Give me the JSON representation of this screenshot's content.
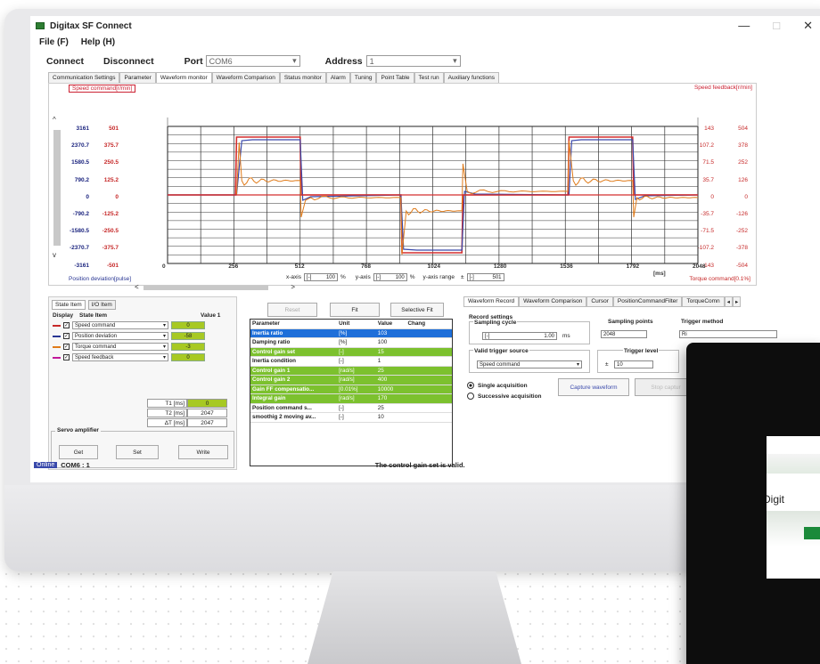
{
  "window": {
    "title": "Digitax SF Connect",
    "min": "—",
    "max": "□",
    "close": "✕"
  },
  "menu": {
    "file": "File (F)",
    "help": "Help (H)"
  },
  "conn": {
    "connect": "Connect",
    "disconnect": "Disconnect",
    "port_label": "Port",
    "port_value": "COM6",
    "address_label": "Address",
    "address_value": "1"
  },
  "tabs": [
    "Communication Settings",
    "Parameter",
    "Waveform monitor",
    "Waveform Comparison",
    "Status monitor",
    "Alarm",
    "Tuning",
    "Point Table",
    "Test run",
    "Auxiliary functions"
  ],
  "monitor": {
    "speed_command": "Speed command[r/min]",
    "speed_feedback": "Speed feedback[r/min]",
    "position_deviation": "Position deviation[pulse]",
    "torque_command": "Torque command[0.1%]",
    "left_axis_1": [
      "3161",
      "2370.7",
      "1580.5",
      "790.2",
      "0",
      "-790.2",
      "-1580.5",
      "-2370.7",
      "-3161"
    ],
    "left_axis_2": [
      "501",
      "375.7",
      "250.5",
      "125.2",
      "0",
      "-125.2",
      "-250.5",
      "-375.7",
      "-501"
    ],
    "right_axis_1": [
      "143",
      "107.2",
      "71.5",
      "35.7",
      "0",
      "-35.7",
      "-71.5",
      "-107.2",
      "-143"
    ],
    "right_axis_2": [
      "504",
      "378",
      "252",
      "126",
      "0",
      "-126",
      "-252",
      "-378",
      "-504"
    ],
    "x_ticks": [
      "0",
      "256",
      "512",
      "768",
      "1024",
      "1280",
      "1536",
      "1792",
      "2048"
    ],
    "x_unit": "[ms]",
    "xaxis_label": "x-axis",
    "xaxis_value": "100",
    "yaxis_label": "y-axis",
    "yaxis_value": "100",
    "pct": "%",
    "yrange_label": "y-axis range",
    "yrange_pm": "±",
    "yrange_value": "501"
  },
  "state": {
    "tab1": "State Item",
    "tab2": "I/O Item",
    "col_display": "Display",
    "col_item": "State Item",
    "col_value": "Value 1",
    "items": [
      {
        "label": "Speed command",
        "value": "0",
        "color": "#c62828"
      },
      {
        "label": "Position deviation",
        "value": "-58",
        "color": "#283593"
      },
      {
        "label": "Torque command",
        "value": "-3",
        "color": "#e07b1a"
      },
      {
        "label": "Speed feedback",
        "value": "0",
        "color": "#c2189a"
      }
    ],
    "t1_label": "T1 [ms]",
    "t1_value": "0",
    "t2_label": "T2 [ms]",
    "t2_value": "2047",
    "dt_label": "ΔT [ms]",
    "dt_value": "2047",
    "servo_label": "Servo amplifier",
    "btn_get": "Get",
    "btn_set": "Set",
    "btn_write": "Write"
  },
  "actions": {
    "reset": "Reset",
    "fit": "Fit",
    "selective_fit": "Selective Fit"
  },
  "params": {
    "headers": [
      "Parameter",
      "Unit",
      "Value",
      "Chang"
    ],
    "rows": [
      {
        "name": "Inertia ratio",
        "unit": "[%]",
        "value": "103",
        "hl": "blue"
      },
      {
        "name": "Damping ratio",
        "unit": "[%]",
        "value": "100",
        "hl": ""
      },
      {
        "name": "Control gain set",
        "unit": "[-]",
        "value": "15",
        "hl": "green"
      },
      {
        "name": "Inertia condition",
        "unit": "[-]",
        "value": "1",
        "hl": ""
      },
      {
        "name": "Control gain 1",
        "unit": "[rad/s]",
        "value": "25",
        "hl": "green"
      },
      {
        "name": "Control gain 2",
        "unit": "[rad/s]",
        "value": "400",
        "hl": "green"
      },
      {
        "name": "Gain FF compensatio...",
        "unit": "[0.01%]",
        "value": "10000",
        "hl": "green"
      },
      {
        "name": "Integral gain",
        "unit": "[rad/s]",
        "value": "170",
        "hl": "green"
      },
      {
        "name": "Position command s...",
        "unit": "[-]",
        "value": "25",
        "hl": ""
      },
      {
        "name": "smoothig 2 moving av...",
        "unit": "[-]",
        "value": "10",
        "hl": ""
      }
    ]
  },
  "record": {
    "tabs": [
      "Waveform Record",
      "Waveform Comparison",
      "Cursor",
      "PositionCommandFilter",
      "TorqueComn"
    ],
    "settings_label": "Record settings",
    "sampling_cycle_label": "Sampling cycle",
    "sampling_cycle_value": "1.00",
    "sampling_cycle_unit": "ms",
    "sampling_points_label": "Sampling points",
    "sampling_points_value": "2048",
    "trigger_method_label": "Trigger method",
    "trigger_method_value": "Ri",
    "trigger_source_label": "Valid trigger source",
    "trigger_source_value": "Speed command",
    "trigger_level_label": "Trigger level",
    "trigger_level_pm": "±",
    "trigger_level_value": "10",
    "single": "Single acquisition",
    "successive": "Successive acquisition",
    "capture": "Capture waveform",
    "stop": "Stop captur"
  },
  "status": {
    "online": "Online",
    "com": "COM6 : 1",
    "message": "The control gain set is valid."
  },
  "tablet": {
    "text": "Digit"
  },
  "colors": {
    "speed_cmd": "#d32f2f",
    "pos_dev": "#3949ab",
    "torque": "#e07b1a",
    "green_hl": "#7cc12e",
    "blue_hl": "#1e6fd9"
  }
}
